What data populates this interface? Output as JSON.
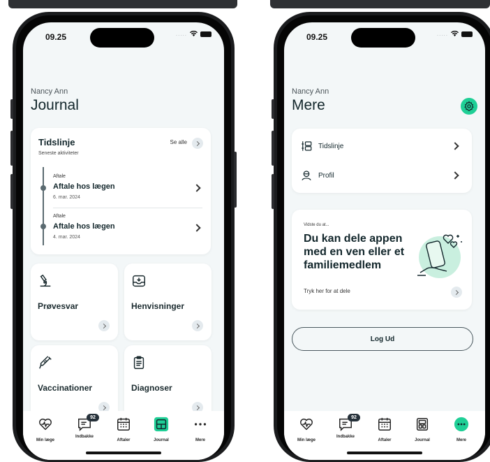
{
  "status": {
    "time": "09.25",
    "signal_dots": "....."
  },
  "left": {
    "user_name": "Nancy Ann",
    "page_title": "Journal",
    "timeline": {
      "title": "Tidslinje",
      "subtitle": "Seneste aktiviteter",
      "see_all": "Se alle",
      "entries": [
        {
          "tag": "Aftale",
          "title": "Aftale hos lægen",
          "date": "6. mar. 2024"
        },
        {
          "tag": "Aftale",
          "title": "Aftale hos lægen",
          "date": "4. mar. 2024"
        }
      ]
    },
    "tiles": [
      {
        "label": "Prøvesvar",
        "icon": "microscope-icon"
      },
      {
        "label": "Henvisninger",
        "icon": "inbox-icon"
      },
      {
        "label": "Vaccinationer",
        "icon": "syringe-icon"
      },
      {
        "label": "Diagnoser",
        "icon": "clipboard-icon"
      }
    ]
  },
  "right": {
    "user_name": "Nancy Ann",
    "page_title": "Mere",
    "menu": [
      {
        "label": "Tidslinje",
        "icon": "timeline-icon"
      },
      {
        "label": "Profil",
        "icon": "profile-icon"
      }
    ],
    "promo": {
      "eyebrow": "Vidste du at...",
      "headline": "Du kan dele appen med en ven eller et familiemedlem",
      "cta": "Tryk her for at dele"
    },
    "logout_label": "Log Ud"
  },
  "tabbar": {
    "tabs": [
      {
        "label": "Min læge",
        "icon": "heart-icon"
      },
      {
        "label": "Indbakke",
        "icon": "chat-icon",
        "badge": "92"
      },
      {
        "label": "Aftaler",
        "icon": "calendar-icon"
      },
      {
        "label": "Journal",
        "icon": "journal-icon"
      },
      {
        "label": "Mere",
        "icon": "more-icon"
      }
    ]
  },
  "colors": {
    "accent": "#1fcf96",
    "background": "#f3f7f8",
    "text": "#12262b"
  }
}
